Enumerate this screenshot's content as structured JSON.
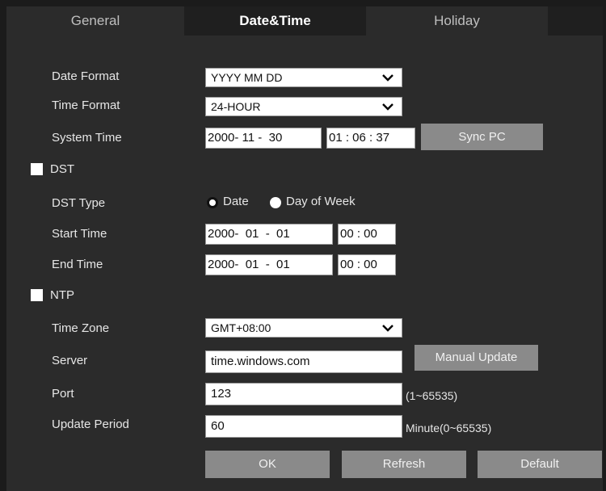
{
  "tabs": [
    {
      "label": "General"
    },
    {
      "label": "Date&Time"
    },
    {
      "label": "Holiday"
    }
  ],
  "date_format": {
    "label": "Date Format",
    "value": "YYYY MM DD"
  },
  "time_format": {
    "label": "Time Format",
    "value": "24-HOUR"
  },
  "system_time": {
    "label": "System Time",
    "date": "2000- 11 -  30",
    "time": "01 : 06 : 37",
    "sync_label": "Sync PC"
  },
  "dst": {
    "label": "DST",
    "checked": false
  },
  "dst_type": {
    "label": "DST Type",
    "options": [
      "Date",
      "Day of Week"
    ],
    "selected": "Date"
  },
  "start_time": {
    "label": "Start Time",
    "date": "2000-  01  -  01",
    "time": "00 : 00"
  },
  "end_time": {
    "label": "End Time",
    "date": "2000-  01  -  01",
    "time": "00 : 00"
  },
  "ntp": {
    "label": "NTP",
    "checked": false
  },
  "time_zone": {
    "label": "Time Zone",
    "value": "GMT+08:00"
  },
  "server": {
    "label": "Server",
    "value": "time.windows.com",
    "manual_update_label": "Manual Update"
  },
  "port": {
    "label": "Port",
    "value": "123",
    "hint": "(1~65535)"
  },
  "update_period": {
    "label": "Update Period",
    "value": "60",
    "hint": "Minute(0~65535)"
  },
  "footer": {
    "ok_label": "OK",
    "refresh_label": "Refresh",
    "default_label": "Default"
  },
  "colors": {
    "panel_bg": "#2b2b2b",
    "active_tab_bg": "#1f1f1f",
    "button_bg": "#8a8a8a"
  },
  "icons": {
    "dropdown": "chevron-down-icon",
    "checkbox": "checkbox-icon",
    "radio": "radio-icon"
  }
}
